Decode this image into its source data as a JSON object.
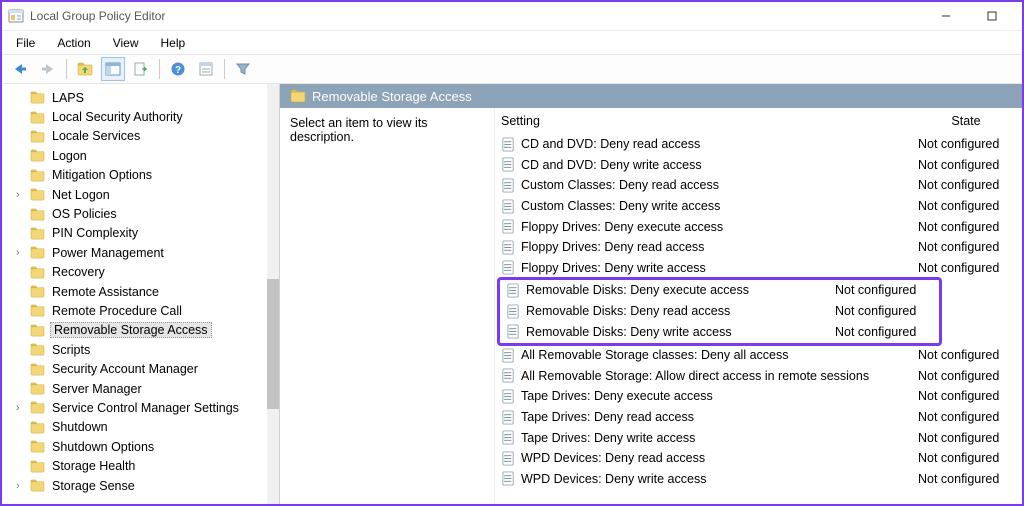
{
  "window": {
    "title": "Local Group Policy Editor"
  },
  "menus": [
    "File",
    "Action",
    "View",
    "Help"
  ],
  "tree": {
    "items": [
      {
        "label": "LAPS",
        "expandable": false
      },
      {
        "label": "Local Security Authority",
        "expandable": false
      },
      {
        "label": "Locale Services",
        "expandable": false
      },
      {
        "label": "Logon",
        "expandable": false
      },
      {
        "label": "Mitigation Options",
        "expandable": false
      },
      {
        "label": "Net Logon",
        "expandable": true
      },
      {
        "label": "OS Policies",
        "expandable": false
      },
      {
        "label": "PIN Complexity",
        "expandable": false
      },
      {
        "label": "Power Management",
        "expandable": true
      },
      {
        "label": "Recovery",
        "expandable": false
      },
      {
        "label": "Remote Assistance",
        "expandable": false
      },
      {
        "label": "Remote Procedure Call",
        "expandable": false
      },
      {
        "label": "Removable Storage Access",
        "expandable": false,
        "selected": true
      },
      {
        "label": "Scripts",
        "expandable": false
      },
      {
        "label": "Security Account Manager",
        "expandable": false
      },
      {
        "label": "Server Manager",
        "expandable": false
      },
      {
        "label": "Service Control Manager Settings",
        "expandable": true
      },
      {
        "label": "Shutdown",
        "expandable": false
      },
      {
        "label": "Shutdown Options",
        "expandable": false
      },
      {
        "label": "Storage Health",
        "expandable": false
      },
      {
        "label": "Storage Sense",
        "expandable": true
      }
    ]
  },
  "detail": {
    "section_title": "Removable Storage Access",
    "description_prompt": "Select an item to view its description.",
    "columns": {
      "setting": "Setting",
      "state": "State"
    },
    "rows": [
      {
        "name": "CD and DVD: Deny read access",
        "state": "Not configured"
      },
      {
        "name": "CD and DVD: Deny write access",
        "state": "Not configured"
      },
      {
        "name": "Custom Classes: Deny read access",
        "state": "Not configured"
      },
      {
        "name": "Custom Classes: Deny write access",
        "state": "Not configured"
      },
      {
        "name": "Floppy Drives: Deny execute access",
        "state": "Not configured"
      },
      {
        "name": "Floppy Drives: Deny read access",
        "state": "Not configured"
      },
      {
        "name": "Floppy Drives: Deny write access",
        "state": "Not configured"
      },
      {
        "name": "Removable Disks: Deny execute access",
        "state": "Not configured",
        "highlighted": true
      },
      {
        "name": "Removable Disks: Deny read access",
        "state": "Not configured",
        "highlighted": true
      },
      {
        "name": "Removable Disks: Deny write access",
        "state": "Not configured",
        "highlighted": true
      },
      {
        "name": "All Removable Storage classes: Deny all access",
        "state": "Not configured"
      },
      {
        "name": "All Removable Storage: Allow direct access in remote sessions",
        "state": "Not configured"
      },
      {
        "name": "Tape Drives: Deny execute access",
        "state": "Not configured"
      },
      {
        "name": "Tape Drives: Deny read access",
        "state": "Not configured"
      },
      {
        "name": "Tape Drives: Deny write access",
        "state": "Not configured"
      },
      {
        "name": "WPD Devices: Deny read access",
        "state": "Not configured"
      },
      {
        "name": "WPD Devices: Deny write access",
        "state": "Not configured"
      }
    ]
  }
}
